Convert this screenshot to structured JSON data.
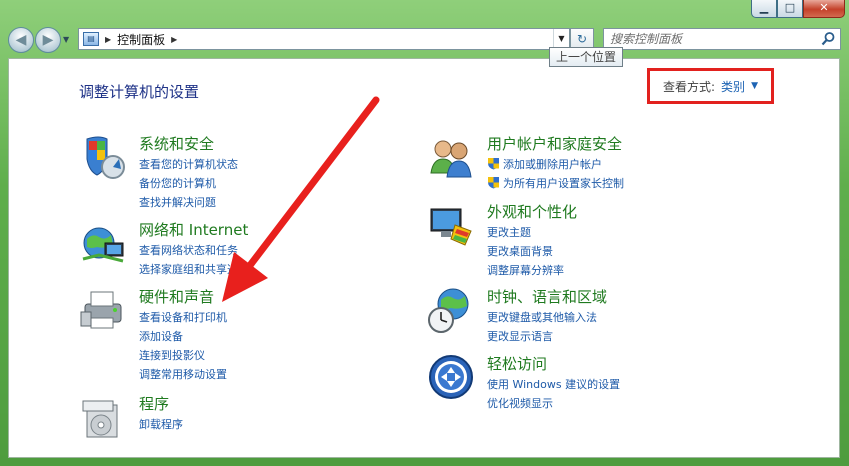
{
  "window": {
    "minimize_label": "▁",
    "maximize_label": "□",
    "close_label": "✕"
  },
  "nav": {
    "back_icon": "back-arrow-icon",
    "forward_icon": "forward-arrow-icon",
    "breadcrumb_sep": "▶",
    "breadcrumb_item": "控制面板",
    "breadcrumb_sep_end": "▶",
    "dropdown_arrow": "▼",
    "refresh_label": "↻",
    "search_placeholder": "搜索控制面板",
    "tooltip": "上一个位置"
  },
  "main": {
    "title": "调整计算机的设置",
    "viewby_label": "查看方式:",
    "viewby_value": "类别",
    "viewby_arrow": "▼"
  },
  "categories_left": [
    {
      "title": "系统和安全",
      "icon": "system-security-icon",
      "links": [
        "查看您的计算机状态",
        "备份您的计算机",
        "查找并解决问题"
      ]
    },
    {
      "title": "网络和 Internet",
      "icon": "network-icon",
      "links": [
        "查看网络状态和任务",
        "选择家庭组和共享选项"
      ]
    },
    {
      "title": "硬件和声音",
      "icon": "printer-icon",
      "links": [
        "查看设备和打印机",
        "添加设备",
        "连接到投影仪",
        "调整常用移动设置"
      ]
    },
    {
      "title": "程序",
      "icon": "programs-icon",
      "links": [
        "卸载程序"
      ]
    }
  ],
  "categories_right": [
    {
      "title": "用户帐户和家庭安全",
      "icon": "users-icon",
      "links": [
        "添加或删除用户帐户",
        "为所有用户设置家长控制"
      ]
    },
    {
      "title": "外观和个性化",
      "icon": "appearance-icon",
      "links": [
        "更改主题",
        "更改桌面背景",
        "调整屏幕分辨率"
      ]
    },
    {
      "title": "时钟、语言和区域",
      "icon": "clock-globe-icon",
      "links": [
        "更改键盘或其他输入法",
        "更改显示语言"
      ]
    },
    {
      "title": "轻松访问",
      "icon": "ease-of-access-icon",
      "links": [
        "使用 Windows 建议的设置",
        "优化视频显示"
      ]
    }
  ],
  "colors": {
    "title_blue": "#1e3287",
    "category_green": "#1f7a1f",
    "link_blue": "#1e5aa8",
    "highlight_red": "#e2211e"
  }
}
